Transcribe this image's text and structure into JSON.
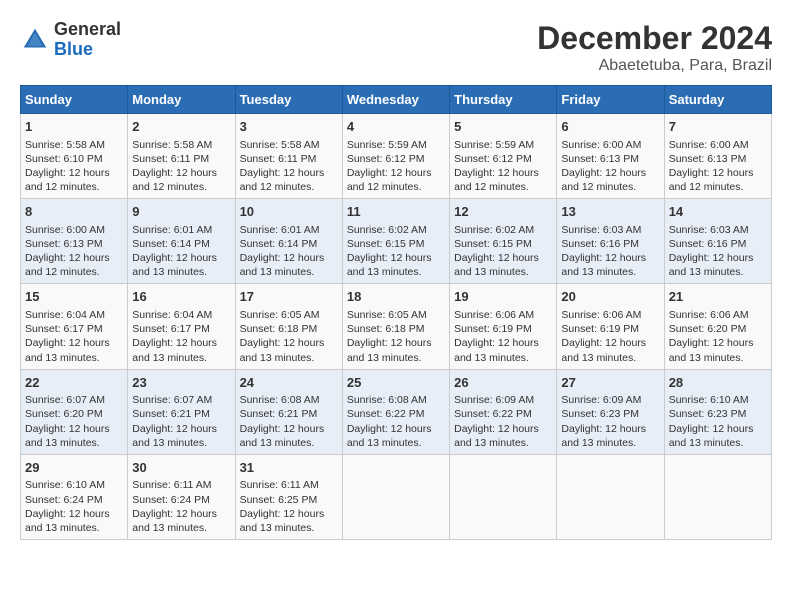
{
  "header": {
    "logo_general": "General",
    "logo_blue": "Blue",
    "title": "December 2024",
    "subtitle": "Abaetetuba, Para, Brazil"
  },
  "calendar": {
    "days_of_week": [
      "Sunday",
      "Monday",
      "Tuesday",
      "Wednesday",
      "Thursday",
      "Friday",
      "Saturday"
    ],
    "weeks": [
      [
        {
          "day": "1",
          "sunrise": "5:58 AM",
          "sunset": "6:10 PM",
          "daylight": "12 hours and 12 minutes."
        },
        {
          "day": "2",
          "sunrise": "5:58 AM",
          "sunset": "6:11 PM",
          "daylight": "12 hours and 12 minutes."
        },
        {
          "day": "3",
          "sunrise": "5:58 AM",
          "sunset": "6:11 PM",
          "daylight": "12 hours and 12 minutes."
        },
        {
          "day": "4",
          "sunrise": "5:59 AM",
          "sunset": "6:12 PM",
          "daylight": "12 hours and 12 minutes."
        },
        {
          "day": "5",
          "sunrise": "5:59 AM",
          "sunset": "6:12 PM",
          "daylight": "12 hours and 12 minutes."
        },
        {
          "day": "6",
          "sunrise": "6:00 AM",
          "sunset": "6:13 PM",
          "daylight": "12 hours and 12 minutes."
        },
        {
          "day": "7",
          "sunrise": "6:00 AM",
          "sunset": "6:13 PM",
          "daylight": "12 hours and 12 minutes."
        }
      ],
      [
        {
          "day": "8",
          "sunrise": "6:00 AM",
          "sunset": "6:13 PM",
          "daylight": "12 hours and 12 minutes."
        },
        {
          "day": "9",
          "sunrise": "6:01 AM",
          "sunset": "6:14 PM",
          "daylight": "12 hours and 13 minutes."
        },
        {
          "day": "10",
          "sunrise": "6:01 AM",
          "sunset": "6:14 PM",
          "daylight": "12 hours and 13 minutes."
        },
        {
          "day": "11",
          "sunrise": "6:02 AM",
          "sunset": "6:15 PM",
          "daylight": "12 hours and 13 minutes."
        },
        {
          "day": "12",
          "sunrise": "6:02 AM",
          "sunset": "6:15 PM",
          "daylight": "12 hours and 13 minutes."
        },
        {
          "day": "13",
          "sunrise": "6:03 AM",
          "sunset": "6:16 PM",
          "daylight": "12 hours and 13 minutes."
        },
        {
          "day": "14",
          "sunrise": "6:03 AM",
          "sunset": "6:16 PM",
          "daylight": "12 hours and 13 minutes."
        }
      ],
      [
        {
          "day": "15",
          "sunrise": "6:04 AM",
          "sunset": "6:17 PM",
          "daylight": "12 hours and 13 minutes."
        },
        {
          "day": "16",
          "sunrise": "6:04 AM",
          "sunset": "6:17 PM",
          "daylight": "12 hours and 13 minutes."
        },
        {
          "day": "17",
          "sunrise": "6:05 AM",
          "sunset": "6:18 PM",
          "daylight": "12 hours and 13 minutes."
        },
        {
          "day": "18",
          "sunrise": "6:05 AM",
          "sunset": "6:18 PM",
          "daylight": "12 hours and 13 minutes."
        },
        {
          "day": "19",
          "sunrise": "6:06 AM",
          "sunset": "6:19 PM",
          "daylight": "12 hours and 13 minutes."
        },
        {
          "day": "20",
          "sunrise": "6:06 AM",
          "sunset": "6:19 PM",
          "daylight": "12 hours and 13 minutes."
        },
        {
          "day": "21",
          "sunrise": "6:06 AM",
          "sunset": "6:20 PM",
          "daylight": "12 hours and 13 minutes."
        }
      ],
      [
        {
          "day": "22",
          "sunrise": "6:07 AM",
          "sunset": "6:20 PM",
          "daylight": "12 hours and 13 minutes."
        },
        {
          "day": "23",
          "sunrise": "6:07 AM",
          "sunset": "6:21 PM",
          "daylight": "12 hours and 13 minutes."
        },
        {
          "day": "24",
          "sunrise": "6:08 AM",
          "sunset": "6:21 PM",
          "daylight": "12 hours and 13 minutes."
        },
        {
          "day": "25",
          "sunrise": "6:08 AM",
          "sunset": "6:22 PM",
          "daylight": "12 hours and 13 minutes."
        },
        {
          "day": "26",
          "sunrise": "6:09 AM",
          "sunset": "6:22 PM",
          "daylight": "12 hours and 13 minutes."
        },
        {
          "day": "27",
          "sunrise": "6:09 AM",
          "sunset": "6:23 PM",
          "daylight": "12 hours and 13 minutes."
        },
        {
          "day": "28",
          "sunrise": "6:10 AM",
          "sunset": "6:23 PM",
          "daylight": "12 hours and 13 minutes."
        }
      ],
      [
        {
          "day": "29",
          "sunrise": "6:10 AM",
          "sunset": "6:24 PM",
          "daylight": "12 hours and 13 minutes."
        },
        {
          "day": "30",
          "sunrise": "6:11 AM",
          "sunset": "6:24 PM",
          "daylight": "12 hours and 13 minutes."
        },
        {
          "day": "31",
          "sunrise": "6:11 AM",
          "sunset": "6:25 PM",
          "daylight": "12 hours and 13 minutes."
        },
        null,
        null,
        null,
        null
      ]
    ],
    "labels": {
      "sunrise": "Sunrise:",
      "sunset": "Sunset:",
      "daylight": "Daylight:"
    }
  }
}
